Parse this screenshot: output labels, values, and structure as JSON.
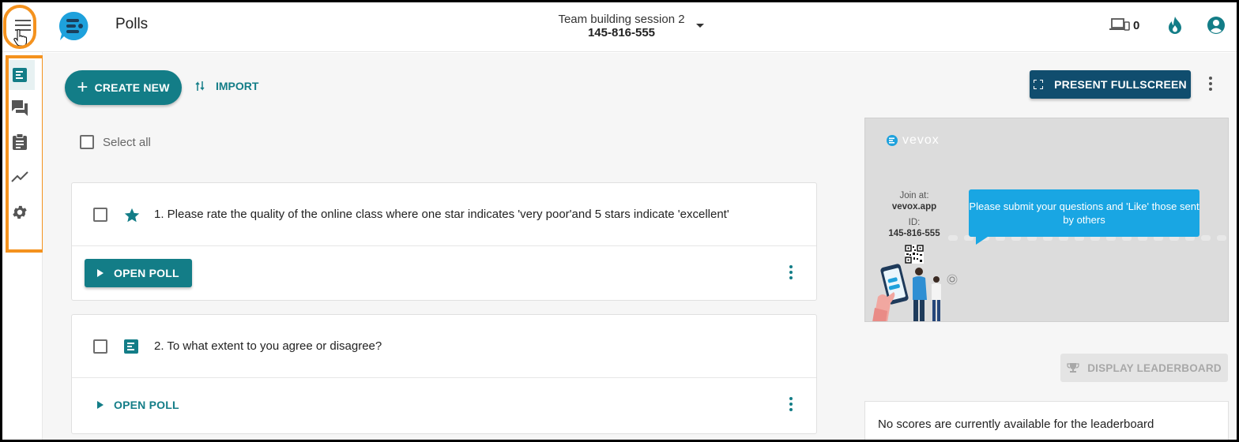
{
  "header": {
    "app_title": "Polls",
    "session_name": "Team building session 2",
    "session_id": "145-816-555",
    "devices_count": "0"
  },
  "sidebar": {
    "items": [
      {
        "name": "polls",
        "icon": "poll-icon",
        "active": true
      },
      {
        "name": "questions",
        "icon": "forum-icon",
        "active": false
      },
      {
        "name": "surveys",
        "icon": "clipboard-icon",
        "active": false
      },
      {
        "name": "reports",
        "icon": "trending-icon",
        "active": false
      },
      {
        "name": "settings",
        "icon": "gear-icon",
        "active": false
      }
    ]
  },
  "toolbar": {
    "create_label": "CREATE NEW",
    "import_label": "IMPORT",
    "present_label": "PRESENT FULLSCREEN",
    "select_all_label": "Select all"
  },
  "polls": [
    {
      "title": "1. Please rate the quality of the online class where one star indicates 'very poor'and 5 stars indicate 'excellent'",
      "type_icon": "star-icon",
      "action_label": "OPEN POLL"
    },
    {
      "title": "2. To what extent to you agree or disagree?",
      "type_icon": "text-poll-icon",
      "action_label": "OPEN POLL"
    }
  ],
  "preview": {
    "brand": "vevox",
    "join_at_label": "Join at:",
    "join_url": "vevox.app",
    "id_label": "ID:",
    "id_value": "145-816-555",
    "bubble_text": "Please submit your questions and 'Like' those sent by others"
  },
  "leaderboard": {
    "button_label": "DISPLAY LEADERBOARD",
    "empty_text": "No scores are currently available for the leaderboard"
  },
  "colors": {
    "accent": "#137d87",
    "present": "#104d6e",
    "highlight": "#f4921e",
    "bubble": "#19a6e3"
  }
}
